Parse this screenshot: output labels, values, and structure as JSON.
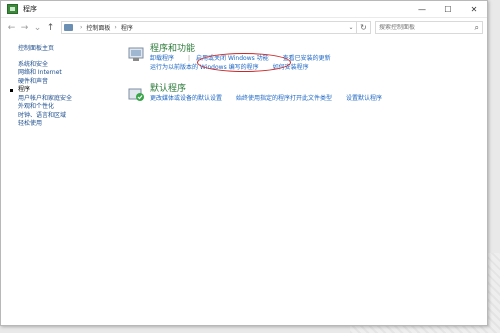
{
  "window": {
    "title": "程序",
    "minimize": "—",
    "maximize": "☐",
    "close": "✕"
  },
  "address": {
    "back": "←",
    "forward": "→",
    "dropdown": "⌄",
    "up": "↑",
    "crumb1": "控制面板",
    "crumb_sep": "›",
    "crumb2": "程序",
    "refresh": "↻",
    "search_placeholder": "搜索控制面板"
  },
  "sidebar": {
    "home": "控制面板主页",
    "items": [
      {
        "label": "系统和安全",
        "active": false
      },
      {
        "label": "网络和 Internet",
        "active": false
      },
      {
        "label": "硬件和声音",
        "active": false
      },
      {
        "label": "程序",
        "active": true
      },
      {
        "label": "用户帐户和家庭安全",
        "active": false
      },
      {
        "label": "外观和个性化",
        "active": false
      },
      {
        "label": "时钟、语言和区域",
        "active": false
      },
      {
        "label": "轻松使用",
        "active": false
      }
    ]
  },
  "sections": [
    {
      "title": "程序和功能",
      "row1": [
        "卸载程序",
        "启用或关闭 Windows 功能",
        "查看已安装的更新"
      ],
      "row2": [
        "运行为以前版本的 Windows 编写的程序",
        "如何安装程序"
      ]
    },
    {
      "title": "默认程序",
      "row1": [
        "更改媒体或设备的默认设置",
        "始终使用指定的程序打开此文件类型",
        "设置默认程序"
      ]
    }
  ],
  "colors": {
    "link": "#1c66c4",
    "section_title": "#2c7a3a",
    "highlight": "#cc2828"
  }
}
